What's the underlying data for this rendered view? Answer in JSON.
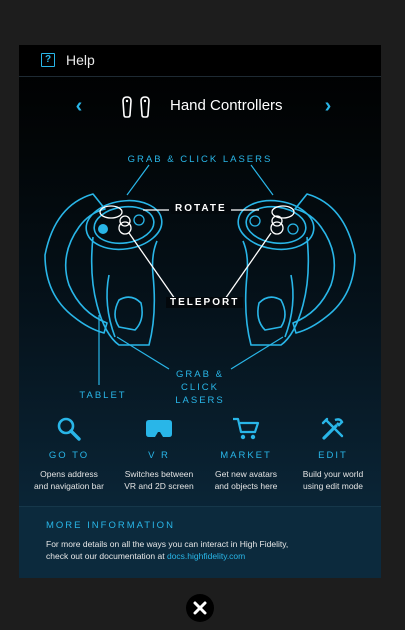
{
  "header": {
    "help_icon": "question-square-icon",
    "help_label": "Help"
  },
  "nav": {
    "prev_icon": "chevron-left-icon",
    "next_icon": "chevron-right-icon",
    "controllers_icon": "hand-controllers-icon",
    "title": "Hand Controllers"
  },
  "diagram": {
    "grab_click_lasers_top": "GRAB & CLICK LASERS",
    "rotate": "ROTATE",
    "teleport": "TELEPORT",
    "tablet": "TABLET",
    "grab_click_lasers_bottom": [
      "GRAB &",
      "CLICK",
      "LASERS"
    ]
  },
  "features": [
    {
      "icon": "search-icon",
      "title": "GO TO",
      "desc": [
        "Opens address",
        "and navigation bar"
      ]
    },
    {
      "icon": "vr-headset-icon",
      "title": "V R",
      "desc": [
        "Switches between",
        "VR and 2D screen"
      ]
    },
    {
      "icon": "shopping-cart-icon",
      "title": "MARKET",
      "desc": [
        "Get new avatars",
        "and objects here"
      ]
    },
    {
      "icon": "edit-tools-icon",
      "title": "EDIT",
      "desc": [
        "Build your world",
        "using edit mode"
      ]
    }
  ],
  "more_info": {
    "title": "MORE INFORMATION",
    "line1": "For more details on all the ways you can interact in High Fidelity,",
    "line2_prefix": "check out our documentation at ",
    "link": "docs.highfidelity.com"
  },
  "close": {
    "icon": "close-icon"
  },
  "colors": {
    "accent": "#29b6e8",
    "panel_bottom": "#0c2a3d",
    "backdrop": "#1d1d1d"
  }
}
